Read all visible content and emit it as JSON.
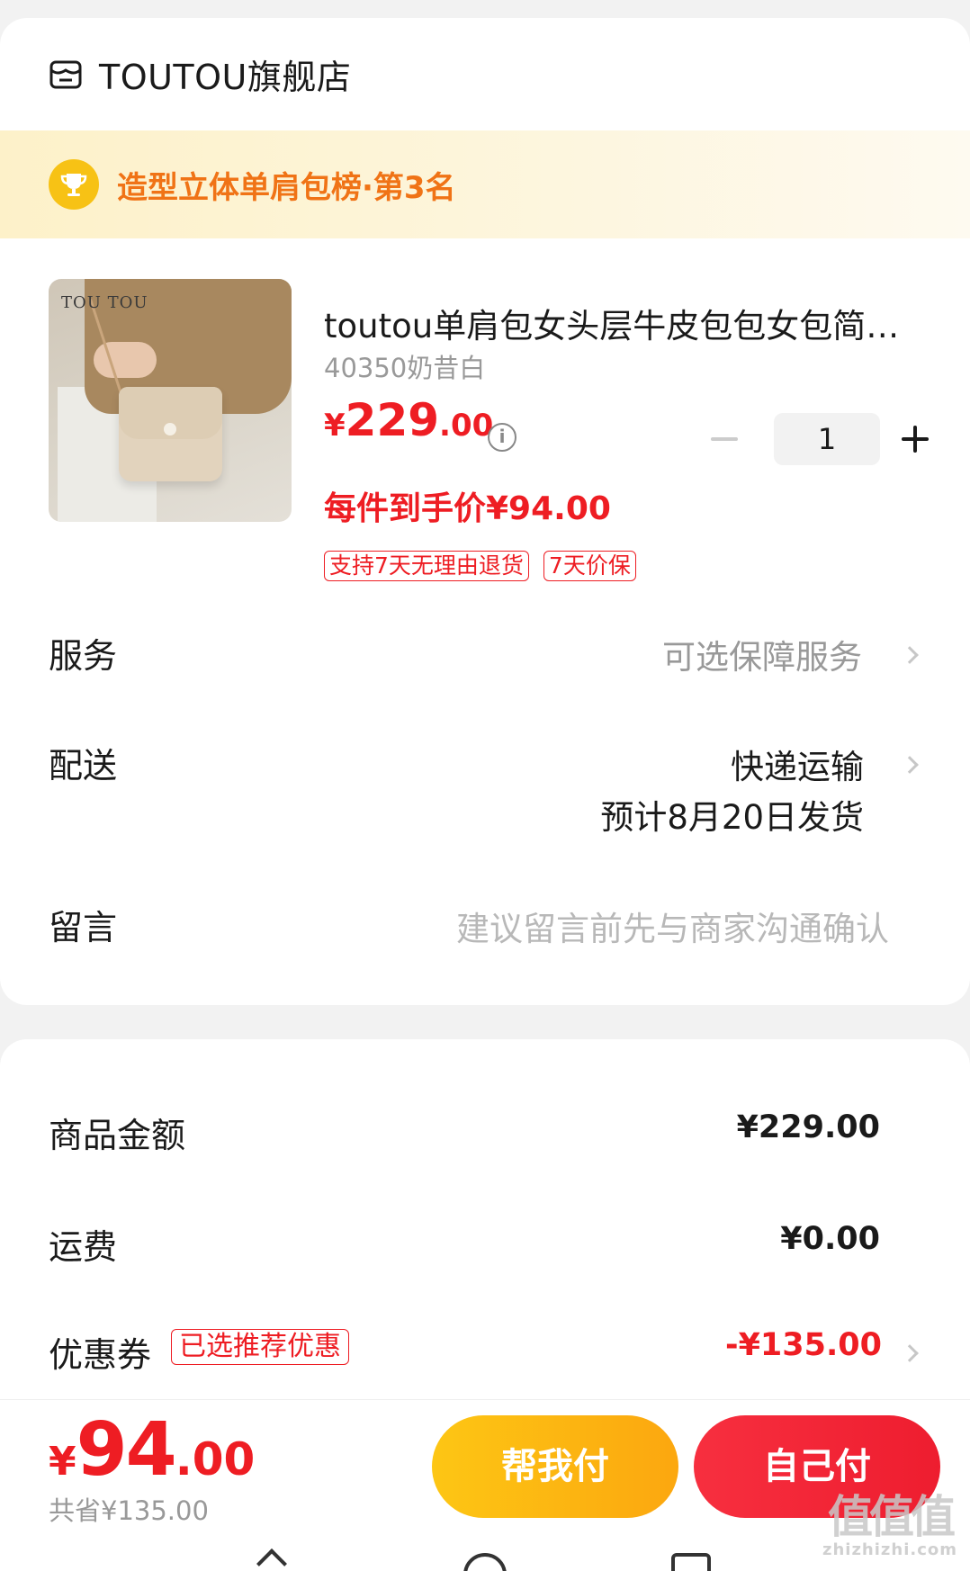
{
  "store": {
    "name": "TOUTOU旗舰店",
    "icon": "store-icon"
  },
  "rank": {
    "text": "造型立体单肩包榜·第3名",
    "icon": "trophy-icon"
  },
  "product": {
    "title": "toutou单肩包女头层牛皮包包女包简…",
    "sku": "40350奶昔白",
    "image_logo": "TOU TOU",
    "price_currency": "¥",
    "price_integer": "229",
    "price_decimal": ".00",
    "final_price": "每件到手价¥94.00",
    "tags": [
      "支持7天无理由退货",
      "7天价保"
    ],
    "quantity": "1"
  },
  "rows": {
    "service": {
      "label": "服务",
      "value": "可选保障服务"
    },
    "delivery": {
      "label": "配送",
      "value": "快递运输",
      "sub": "预计8月20日发货"
    },
    "message": {
      "label": "留言",
      "placeholder": "建议留言前先与商家沟通确认"
    }
  },
  "summary": {
    "goods_label": "商品金额",
    "goods_value": "¥229.00",
    "shipping_label": "运费",
    "shipping_value": "¥0.00",
    "coupon_label": "优惠券",
    "coupon_badge": "已选推荐优惠",
    "coupon_value": "-¥135.00"
  },
  "bottom": {
    "total_currency": "¥",
    "total_integer": "94",
    "total_decimal": ".00",
    "saved": "共省¥135.00",
    "help_pay": "帮我付",
    "self_pay": "自己付"
  },
  "watermark": {
    "big": "值值值",
    "small": "zhizhizhi.com"
  },
  "colors": {
    "accent_red": "#ee1d23",
    "rank_orange": "#f07316",
    "help_yellow": "#fdc614"
  }
}
